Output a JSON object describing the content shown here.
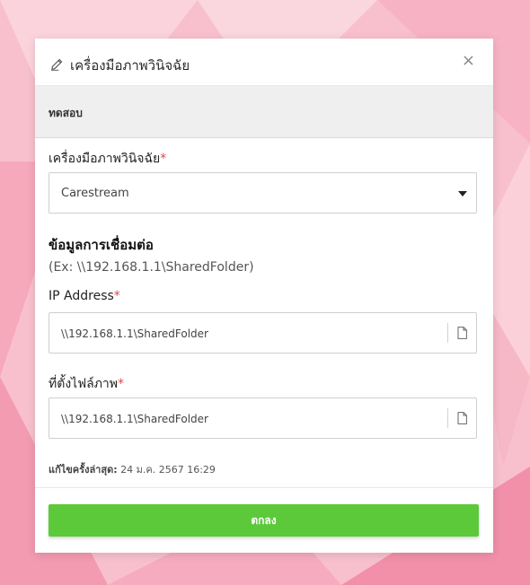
{
  "modal": {
    "title": "เครื่องมือภาพวินิจฉัย",
    "close_label": "×",
    "subheader": "ทดสอบ"
  },
  "form": {
    "device_label": "เครื่องมือภาพวินิจฉัย",
    "device_value": "Carestream",
    "required_mark": "*",
    "connection_title": "ข้อมูลการเชื่อมต่อ",
    "connection_hint": "(Ex: \\\\192.168.1.1\\SharedFolder)",
    "ip_label": "IP Address",
    "ip_value": "\\\\192.168.1.1\\SharedFolder",
    "path_label": "ที่ตั้งไฟล์ภาพ",
    "path_value": "\\\\192.168.1.1\\SharedFolder"
  },
  "meta": {
    "last_edited_label": "แก้ไขครั้งล่าสุด:",
    "last_edited_value": " 24 ม.ค. 2567 16:29"
  },
  "footer": {
    "ok_label": "ตกลง"
  },
  "icons": {
    "edit": "edit-icon",
    "file": "file-icon",
    "dropdown": "chevron-down-icon"
  },
  "colors": {
    "accent_green": "#5cc93a",
    "required_red": "#e04848",
    "background_pink": "#f9c2cf"
  }
}
